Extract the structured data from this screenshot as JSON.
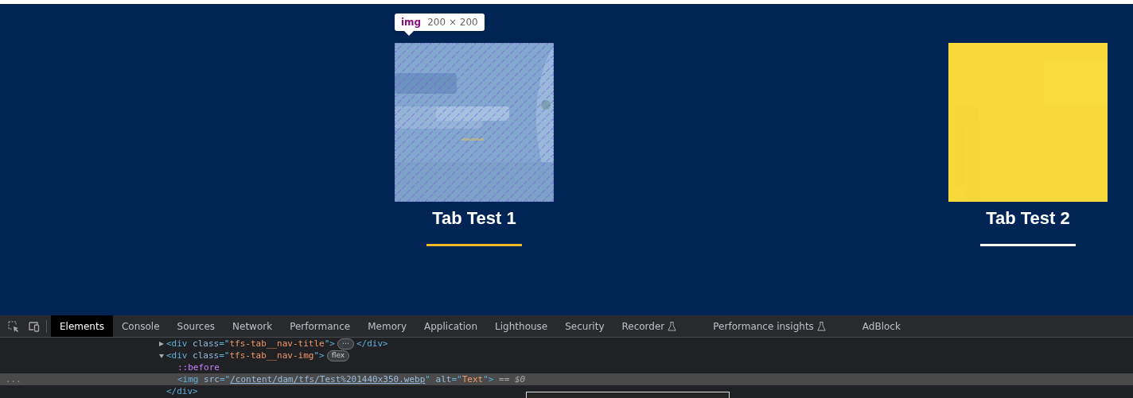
{
  "page_tabs": [
    {
      "label": "Tab Test 1",
      "selected": true,
      "inspected": true,
      "tooltip": {
        "tag": "img",
        "size": "200 × 200"
      }
    },
    {
      "label": "Tab Test 2",
      "selected": false,
      "inspected": false
    }
  ],
  "devtools": {
    "tabs": [
      {
        "label": "Elements",
        "selected": true,
        "experimental": false
      },
      {
        "label": "Console",
        "selected": false,
        "experimental": false
      },
      {
        "label": "Sources",
        "selected": false,
        "experimental": false
      },
      {
        "label": "Network",
        "selected": false,
        "experimental": false
      },
      {
        "label": "Performance",
        "selected": false,
        "experimental": false
      },
      {
        "label": "Memory",
        "selected": false,
        "experimental": false
      },
      {
        "label": "Application",
        "selected": false,
        "experimental": false
      },
      {
        "label": "Lighthouse",
        "selected": false,
        "experimental": false
      },
      {
        "label": "Security",
        "selected": false,
        "experimental": false
      },
      {
        "label": "Recorder",
        "selected": false,
        "experimental": true
      },
      {
        "label": "Performance insights",
        "selected": false,
        "experimental": true
      },
      {
        "label": "AdBlock",
        "selected": false,
        "experimental": false
      }
    ],
    "dom_tree": [
      {
        "expanded": false,
        "selected": false,
        "code": [
          {
            "kind": "tag",
            "text": "<div"
          },
          {
            "kind": "attr",
            "text": " class"
          },
          {
            "kind": "tag",
            "text": "=\""
          },
          {
            "kind": "value",
            "text": "tfs-tab__nav-title"
          },
          {
            "kind": "tag",
            "text": "\">"
          }
        ],
        "badge": "⋯",
        "code_after": [
          {
            "kind": "tag",
            "text": "</div>"
          }
        ]
      },
      {
        "expanded": true,
        "selected": false,
        "code": [
          {
            "kind": "tag",
            "text": "<div"
          },
          {
            "kind": "attr",
            "text": " class"
          },
          {
            "kind": "tag",
            "text": "=\""
          },
          {
            "kind": "value",
            "text": "tfs-tab__nav-img"
          },
          {
            "kind": "tag",
            "text": "\">"
          }
        ],
        "badge": "flex",
        "children": [
          {
            "selected": false,
            "code": [
              {
                "kind": "pseudo",
                "text": "::before"
              }
            ]
          },
          {
            "selected": true,
            "code": [
              {
                "kind": "tag",
                "text": "<img"
              },
              {
                "kind": "attr",
                "text": " src"
              },
              {
                "kind": "tag",
                "text": "=\""
              },
              {
                "kind": "link",
                "text": "/content/dam/tfs/Test%201440x350.webp"
              },
              {
                "kind": "tag",
                "text": "\""
              },
              {
                "kind": "attr",
                "text": " alt"
              },
              {
                "kind": "tag",
                "text": "=\""
              },
              {
                "kind": "value",
                "text": "Text"
              },
              {
                "kind": "tag",
                "text": "\">"
              },
              {
                "kind": "eval",
                "text": " == $0"
              }
            ],
            "gutter": "..."
          }
        ],
        "closing": [
          {
            "kind": "tag",
            "text": "</div>"
          }
        ]
      }
    ]
  }
}
